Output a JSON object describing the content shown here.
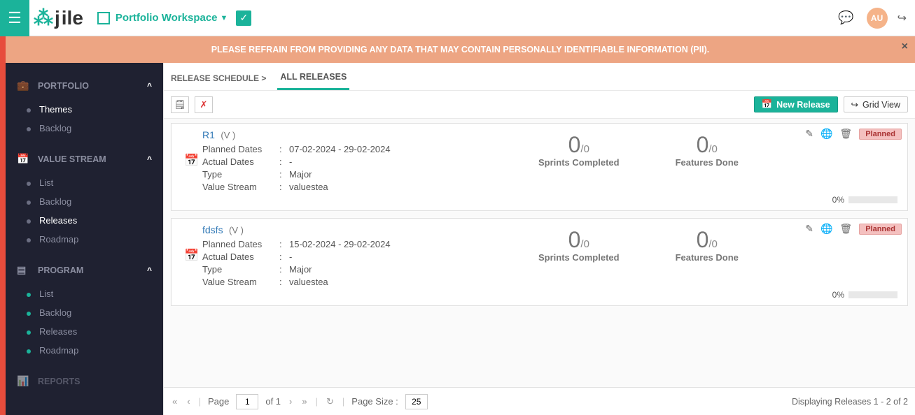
{
  "header": {
    "brand_part1": "j",
    "brand_part2": "ile",
    "workspace_label": "Portfolio Workspace",
    "avatar_initials": "AU"
  },
  "banner": {
    "text": "PLEASE REFRAIN FROM PROVIDING ANY DATA THAT MAY CONTAIN PERSONALLY IDENTIFIABLE INFORMATION (PII)."
  },
  "sidebar": {
    "sections": [
      {
        "title": "PORTFOLIO",
        "items": [
          {
            "label": "Themes"
          },
          {
            "label": "Backlog"
          }
        ]
      },
      {
        "title": "VALUE STREAM",
        "items": [
          {
            "label": "List"
          },
          {
            "label": "Backlog"
          },
          {
            "label": "Releases"
          },
          {
            "label": "Roadmap"
          }
        ]
      },
      {
        "title": "PROGRAM",
        "items": [
          {
            "label": "List"
          },
          {
            "label": "Backlog"
          },
          {
            "label": "Releases"
          },
          {
            "label": "Roadmap"
          }
        ]
      },
      {
        "title": "REPORTS",
        "items": []
      }
    ]
  },
  "crumb": {
    "root": "RELEASE SCHEDULE >",
    "tab": "ALL RELEASES"
  },
  "toolbar": {
    "new_release": "New Release",
    "grid_view": "Grid View"
  },
  "labels": {
    "planned_dates": "Planned Dates",
    "actual_dates": "Actual Dates",
    "type": "Type",
    "value_stream": "Value Stream",
    "sprints_completed": "Sprints Completed",
    "features_done": "Features Done",
    "planned_badge": "Planned"
  },
  "releases": [
    {
      "name": "R1",
      "version": "(V )",
      "planned": "07-02-2024 - 29-02-2024",
      "actual": "-",
      "type": "Major",
      "value_stream": "valuestea",
      "sprints_done": "0",
      "sprints_total": "/0",
      "features_done": "0",
      "features_total": "/0",
      "progress": "0%"
    },
    {
      "name": "fdsfs",
      "version": "(V )",
      "planned": "15-02-2024 - 29-02-2024",
      "actual": "-",
      "type": "Major",
      "value_stream": "valuestea",
      "sprints_done": "0",
      "sprints_total": "/0",
      "features_done": "0",
      "features_total": "/0",
      "progress": "0%"
    }
  ],
  "pager": {
    "page_label": "Page",
    "page_val": "1",
    "of_text": "of 1",
    "size_label": "Page Size :",
    "size_val": "25",
    "info": "Displaying Releases 1 - 2 of 2"
  }
}
